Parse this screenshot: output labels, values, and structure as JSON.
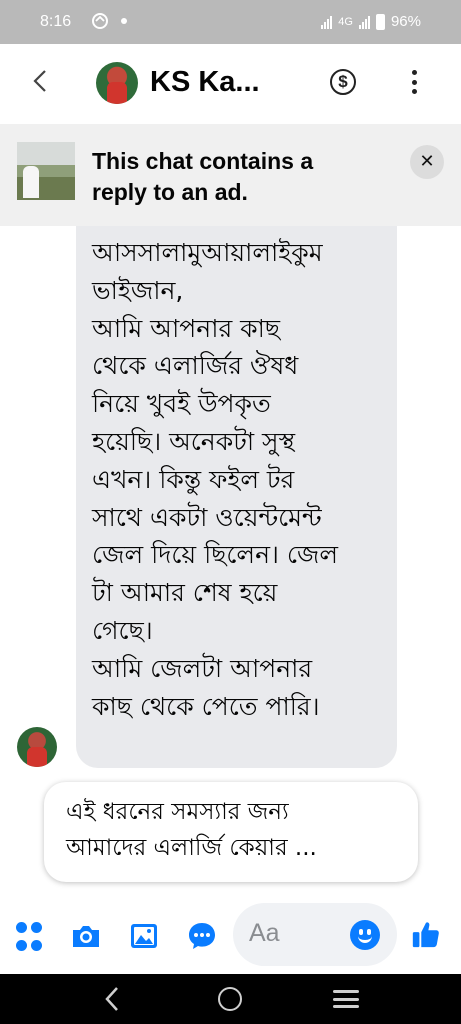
{
  "status_bar": {
    "time": "8:16",
    "network": "4G",
    "battery": "96%"
  },
  "header": {
    "contact_name": "KS Ka...",
    "back_icon": "chevron-left-icon",
    "payment_icon": "dollar-circle-icon",
    "more_icon": "more-vertical-icon"
  },
  "ad_banner": {
    "text": "This chat contains a reply to an ad.",
    "close_icon": "close-icon"
  },
  "messages": {
    "received": {
      "lines": [
        "আসসালামুআয়ালাইকুম",
        "ভাইজান,",
        "আমি আপনার কাছ",
        "থেকে এলার্জির ঔষধ",
        "নিয়ে খুবই উপকৃত",
        "হয়েছি। অনেকটা সুস্থ",
        "এখন।  কিন্তু ফইল টর",
        "সাথে একটা ওয়েন্টমেন্ট",
        "জেল দিয়ে ছিলেন। জেল",
        "টা আমার শেষ হয়ে",
        "গেছে।",
        "আমি জেলটা আপনার",
        "কাছ থেকে পেতে পারি।"
      ]
    },
    "reply_preview": {
      "lines": [
        "এই ধরনের সমস্যার জন্য",
        "আমাদের এলার্জি কেয়ার ..."
      ]
    }
  },
  "composer": {
    "placeholder": "Aa",
    "accent_color": "#0a7cff"
  },
  "colors": {
    "status_bar": "#b9b9b9",
    "received_bubble": "#e9eaed",
    "ad_banner": "#f0f0f0"
  }
}
